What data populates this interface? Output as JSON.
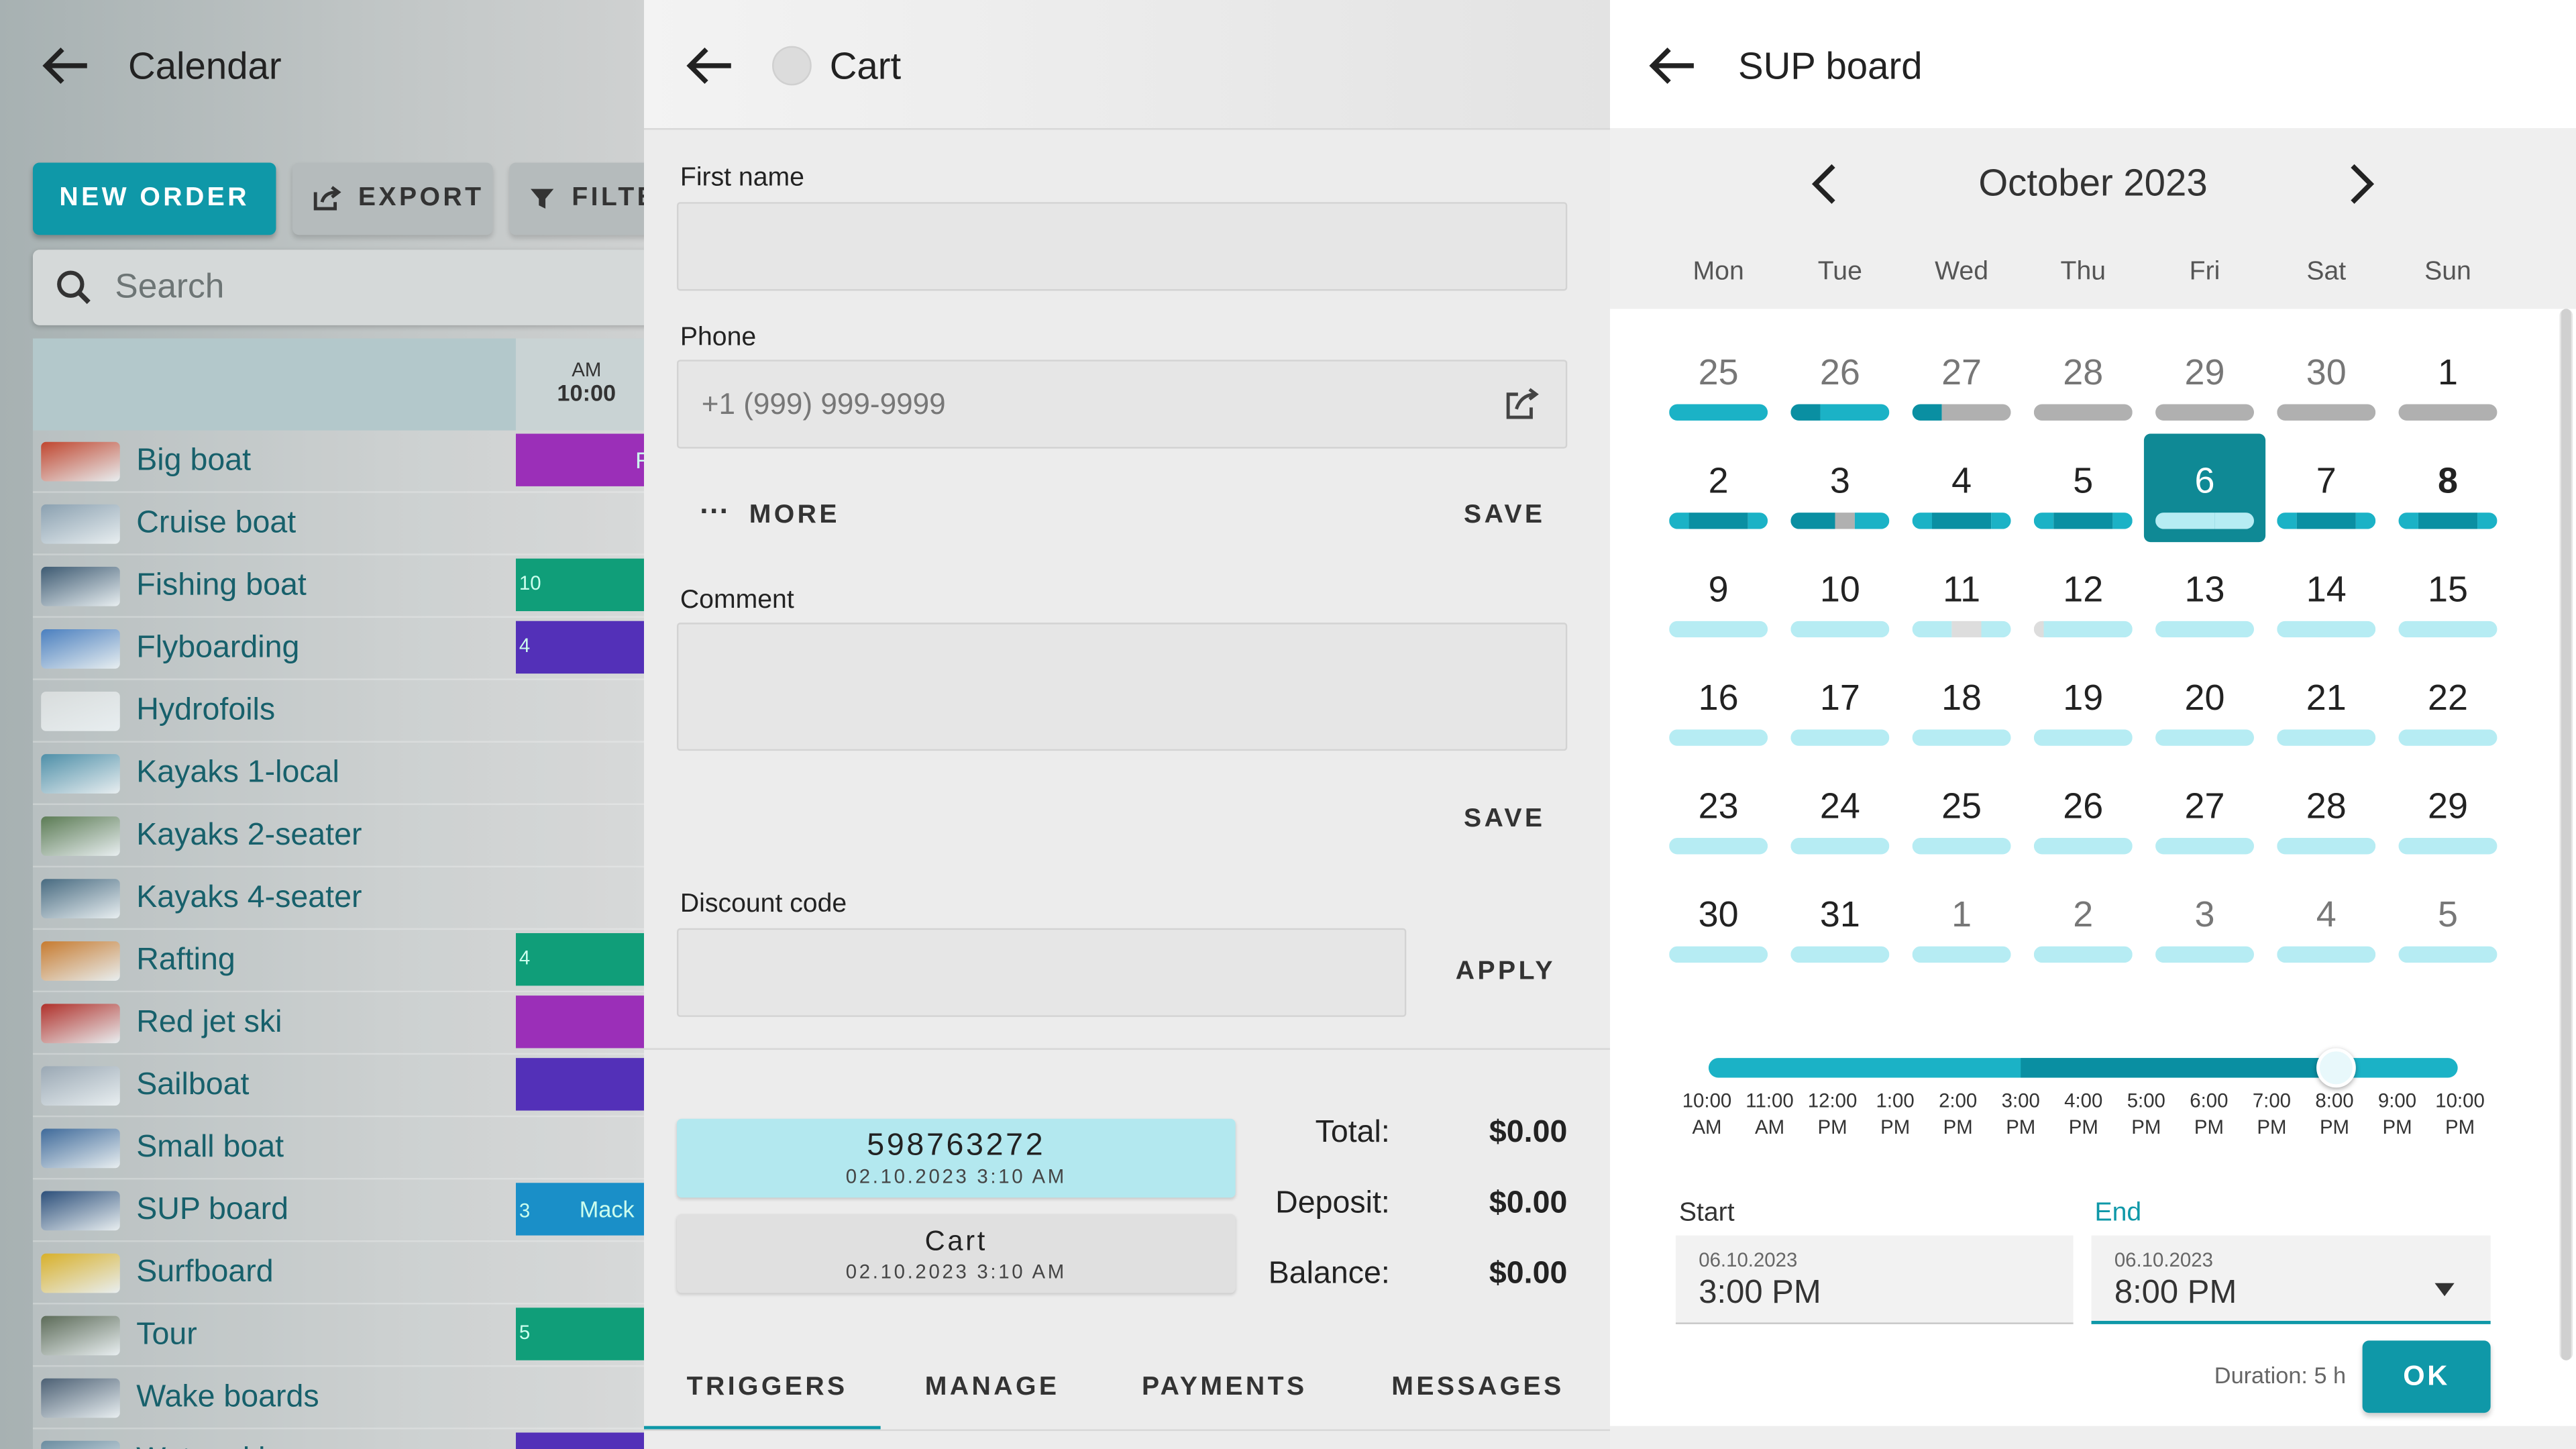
{
  "colors": {
    "accent": "#0f98a8",
    "availability": "#1bb2c6",
    "booked": "#0a8fa2",
    "partial": "#b0b0b0",
    "light": "#b6ecf3"
  },
  "left": {
    "title": "Calendar",
    "new_order": "NEW ORDER",
    "export": "EXPORT",
    "filter": "FILTE",
    "search_placeholder": "Search",
    "time_ampm": "AM",
    "time": "10:00",
    "resources": [
      {
        "name": "Big boat",
        "badge": "Ri"
      },
      {
        "name": "Cruise boat",
        "badge": ""
      },
      {
        "name": "Fishing boat",
        "badge": "10"
      },
      {
        "name": "Flyboarding",
        "badge": "4"
      },
      {
        "name": "Hydrofoils",
        "badge": ""
      },
      {
        "name": "Kayaks 1-local",
        "badge": ""
      },
      {
        "name": "Kayaks 2-seater",
        "badge": ""
      },
      {
        "name": "Kayaks 4-seater",
        "badge": ""
      },
      {
        "name": "Rafting",
        "badge": "4"
      },
      {
        "name": "Red jet ski",
        "badge": ""
      },
      {
        "name": "Sailboat",
        "badge": ""
      },
      {
        "name": "Small boat",
        "badge": ""
      },
      {
        "name": "SUP board",
        "badge": "3",
        "badge2": "Mack"
      },
      {
        "name": "Surfboard",
        "badge": ""
      },
      {
        "name": "Tour",
        "badge": "5"
      },
      {
        "name": "Wake boards",
        "badge": ""
      },
      {
        "name": "Water ski",
        "badge": ""
      }
    ]
  },
  "cart": {
    "title": "Cart",
    "first_name_label": "First name",
    "phone_label": "Phone",
    "phone_placeholder": "+1 (999) 999-9999",
    "more": "MORE",
    "save": "SAVE",
    "comment_label": "Comment",
    "save2": "SAVE",
    "discount_label": "Discount code",
    "apply": "APPLY",
    "order_number": "598763272",
    "order_date": "02.10.2023 3:10 AM",
    "cart_name": "Cart",
    "cart_date": "02.10.2023 3:10 AM",
    "total_label": "Total:",
    "total_value": "$0.00",
    "deposit_label": "Deposit:",
    "deposit_value": "$0.00",
    "balance_label": "Balance:",
    "balance_value": "$0.00",
    "tabs": [
      "TRIGGERS",
      "MANAGE",
      "PAYMENTS",
      "MESSAGES"
    ],
    "active_tab": "TRIGGERS"
  },
  "sup": {
    "title": "SUP board",
    "month": "October 2023",
    "weekdays": [
      "Mon",
      "Tue",
      "Wed",
      "Thu",
      "Fri",
      "Sat",
      "Sun"
    ],
    "days": [
      "25",
      "26",
      "27",
      "28",
      "29",
      "30",
      "1",
      "2",
      "3",
      "4",
      "5",
      "6",
      "7",
      "8",
      "9",
      "10",
      "11",
      "12",
      "13",
      "14",
      "15",
      "16",
      "17",
      "18",
      "19",
      "20",
      "21",
      "22",
      "23",
      "24",
      "25",
      "26",
      "27",
      "28",
      "29",
      "30",
      "31",
      "1",
      "2",
      "3",
      "4",
      "5"
    ],
    "selected_day": "6",
    "today_bold": "8",
    "slider_ticks": [
      [
        "10:00",
        "AM"
      ],
      [
        "11:00",
        "AM"
      ],
      [
        "12:00",
        "PM"
      ],
      [
        "1:00",
        "PM"
      ],
      [
        "2:00",
        "PM"
      ],
      [
        "3:00",
        "PM"
      ],
      [
        "4:00",
        "PM"
      ],
      [
        "5:00",
        "PM"
      ],
      [
        "6:00",
        "PM"
      ],
      [
        "7:00",
        "PM"
      ],
      [
        "8:00",
        "PM"
      ],
      [
        "9:00",
        "PM"
      ],
      [
        "10:00",
        "PM"
      ]
    ],
    "start_label": "Start",
    "end_label": "End",
    "start_date": "06.10.2023",
    "start_time": "3:00 PM",
    "end_date": "06.10.2023",
    "end_time": "8:00 PM",
    "duration": "Duration: 5 h",
    "ok": "OK"
  }
}
